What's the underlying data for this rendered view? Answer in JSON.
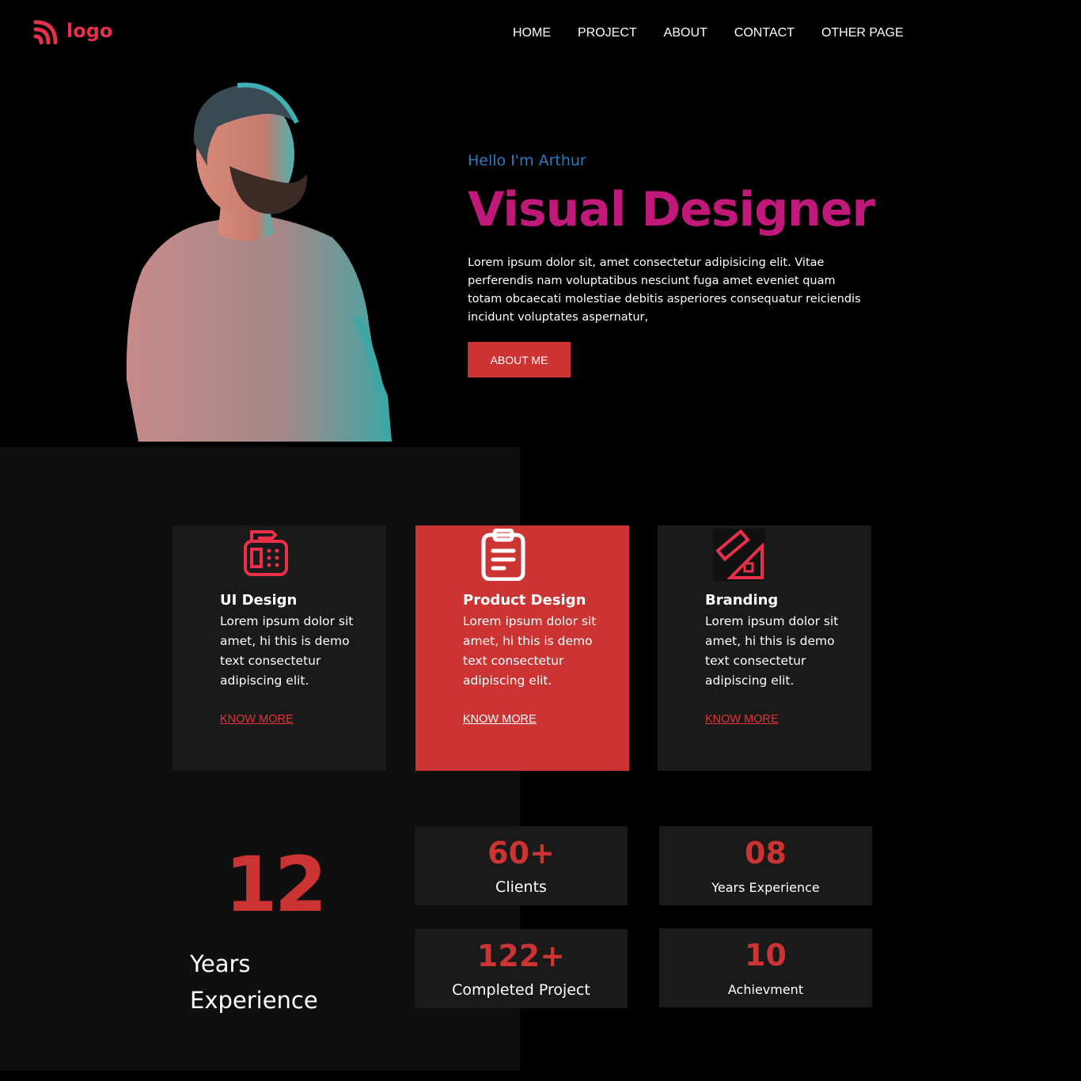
{
  "brand": {
    "logo_text": "logo",
    "accent": "#e8304a",
    "red": "#cc3333",
    "magenta": "#c0197a",
    "blue": "#2b7bbf"
  },
  "nav": {
    "items": [
      "HOME",
      "PROJECT",
      "ABOUT",
      "CONTACT",
      "OTHER PAGE"
    ]
  },
  "hero": {
    "greeting": "Hello I'm Arthur",
    "title": "Visual Designer",
    "description": "Lorem ipsum dolor sit, amet consectetur adipisicing elit. Vitae perferendis nam voluptatibus nesciunt fuga amet eveniet quam totam obcaecati molestiae debitis asperiores consequatur reiciendis incidunt voluptates aspernatur,",
    "button": "ABOUT ME",
    "photo": "man-in-grey-tshirt-photo"
  },
  "services": [
    {
      "icon": "fax-machine-icon",
      "title": "UI Design",
      "text": "Lorem ipsum dolor sit amet, hi this is demo text consectetur adipiscing elit.",
      "link": "KNOW MORE"
    },
    {
      "icon": "clipboard-icon",
      "title": "Product Design",
      "text": "Lorem ipsum dolor sit amet, hi this is demo text consectetur adipiscing elit.",
      "link": "KNOW MORE"
    },
    {
      "icon": "ruler-set-square-icon",
      "title": "Branding",
      "text": "Lorem ipsum dolor sit amet, hi this is demo text consectetur adipiscing elit.",
      "link": "KNOW MORE"
    }
  ],
  "experience": {
    "number": "12",
    "label": "Years Experience"
  },
  "stats": [
    {
      "value": "60+",
      "label": "Clients"
    },
    {
      "value": "08",
      "label": "Years Experience"
    },
    {
      "value": "122+",
      "label": "Completed Project"
    },
    {
      "value": "10",
      "label": "Achievment"
    }
  ]
}
